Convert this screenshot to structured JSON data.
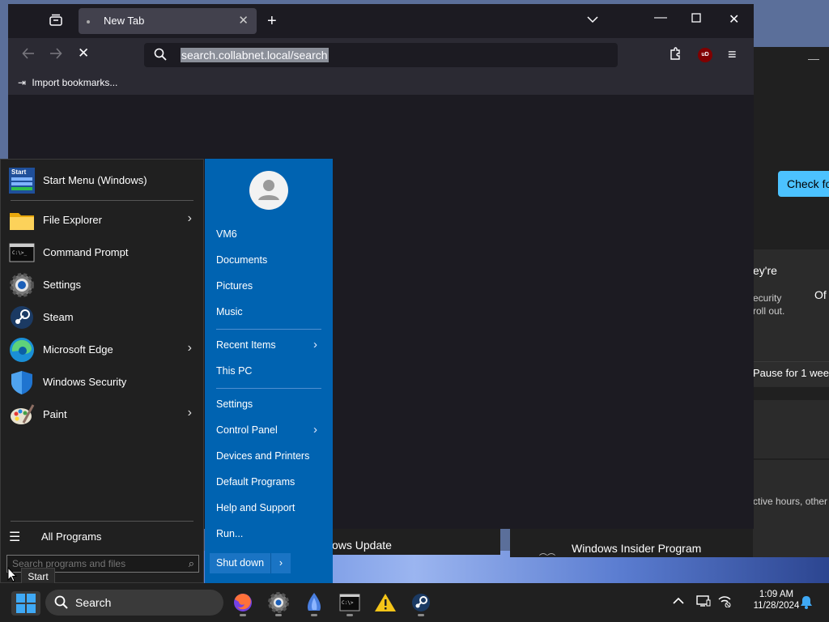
{
  "browser": {
    "tab_title": "New Tab",
    "url": "search.collabnet.local/search",
    "import_bookmarks": "Import bookmarks...",
    "ublock_label": "uD"
  },
  "settings_window": {
    "check_button": "Check fo",
    "card_title": "ey're",
    "card_line1": "ecurity",
    "card_line2": "roll out.",
    "toggle_text": "Of",
    "pause_label": "Pause for 1 wee",
    "active_hours_text": "ctive hours, other",
    "windows_update_label": "ows Update",
    "insider_program": "Windows Insider Program"
  },
  "start_menu": {
    "header": "Start Menu (Windows)",
    "header_icon_text": "Start",
    "pinned": [
      {
        "label": "File Explorer",
        "icon": "folder-icon",
        "has_submenu": true
      },
      {
        "label": "Command Prompt",
        "icon": "terminal-icon",
        "has_submenu": false
      },
      {
        "label": "Settings",
        "icon": "gear-icon",
        "has_submenu": false
      },
      {
        "label": "Steam",
        "icon": "steam-icon",
        "has_submenu": false
      },
      {
        "label": "Microsoft Edge",
        "icon": "edge-icon",
        "has_submenu": true
      },
      {
        "label": "Windows Security",
        "icon": "shield-icon",
        "has_submenu": false
      },
      {
        "label": "Paint",
        "icon": "paint-icon",
        "has_submenu": true
      }
    ],
    "all_programs": "All Programs",
    "search_placeholder": "Search programs and files",
    "right": {
      "user": "VM6",
      "documents": "Documents",
      "pictures": "Pictures",
      "music": "Music",
      "recent_items": "Recent Items",
      "this_pc": "This PC",
      "settings": "Settings",
      "control_panel": "Control Panel",
      "devices_printers": "Devices and Printers",
      "default_programs": "Default Programs",
      "help_support": "Help and Support",
      "run": "Run...",
      "shut_down": "Shut down"
    },
    "tooltip": "Start"
  },
  "taskbar": {
    "search_label": "Search",
    "time": "1:09 AM",
    "date": "11/28/2024"
  }
}
